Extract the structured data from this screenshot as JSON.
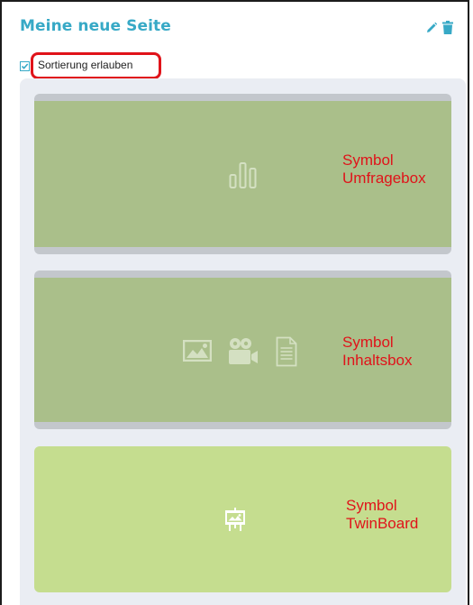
{
  "header": {
    "title": "Meine neue Seite"
  },
  "sort": {
    "label": "Sortierung erlauben",
    "checked": true
  },
  "boxes": [
    {
      "annotation_line1": "Symbol",
      "annotation_line2": "Umfragebox",
      "icons": [
        "bar-chart-icon"
      ]
    },
    {
      "annotation_line1": "Symbol",
      "annotation_line2": "Inhaltsbox",
      "icons": [
        "image-icon",
        "video-camera-icon",
        "document-icon"
      ]
    },
    {
      "annotation_line1": "Symbol",
      "annotation_line2": "TwinBoard",
      "icons": [
        "presentation-board-icon"
      ]
    }
  ],
  "colors": {
    "title": "#37a9c6",
    "annotation": "#e0131a",
    "box_dark": "#aabf8a",
    "box_light": "#c5dd8f",
    "container": "#eaedf3"
  }
}
